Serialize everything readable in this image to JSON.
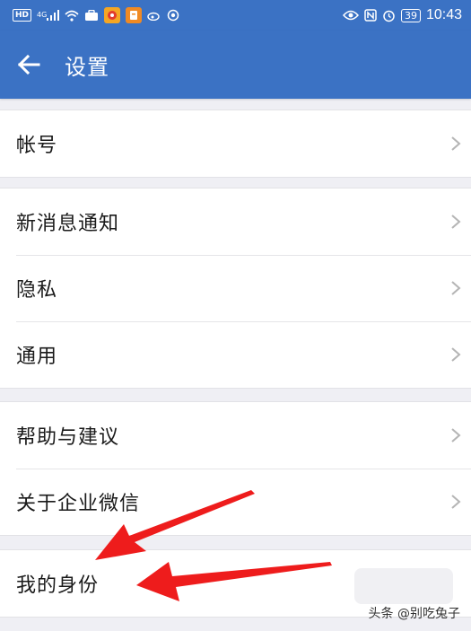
{
  "status_bar": {
    "network_badge": "HD",
    "signal_label": "4G",
    "battery_level": "39",
    "time": "10:43",
    "colors": {
      "bar": "#3b72c4"
    }
  },
  "app_bar": {
    "back_icon": "arrow-left-icon",
    "title": "设置"
  },
  "groups": [
    {
      "items": [
        {
          "label": "帐号"
        }
      ]
    },
    {
      "items": [
        {
          "label": "新消息通知"
        },
        {
          "label": "隐私"
        },
        {
          "label": "通用"
        }
      ]
    },
    {
      "items": [
        {
          "label": "帮助与建议"
        },
        {
          "label": "关于企业微信"
        }
      ]
    },
    {
      "items": [
        {
          "label": "我的身份"
        }
      ]
    }
  ],
  "annotation": {
    "arrow_color": "#ee1c1c",
    "arrow_count": 2
  },
  "watermark": {
    "text": "头条 @别吃兔子"
  }
}
